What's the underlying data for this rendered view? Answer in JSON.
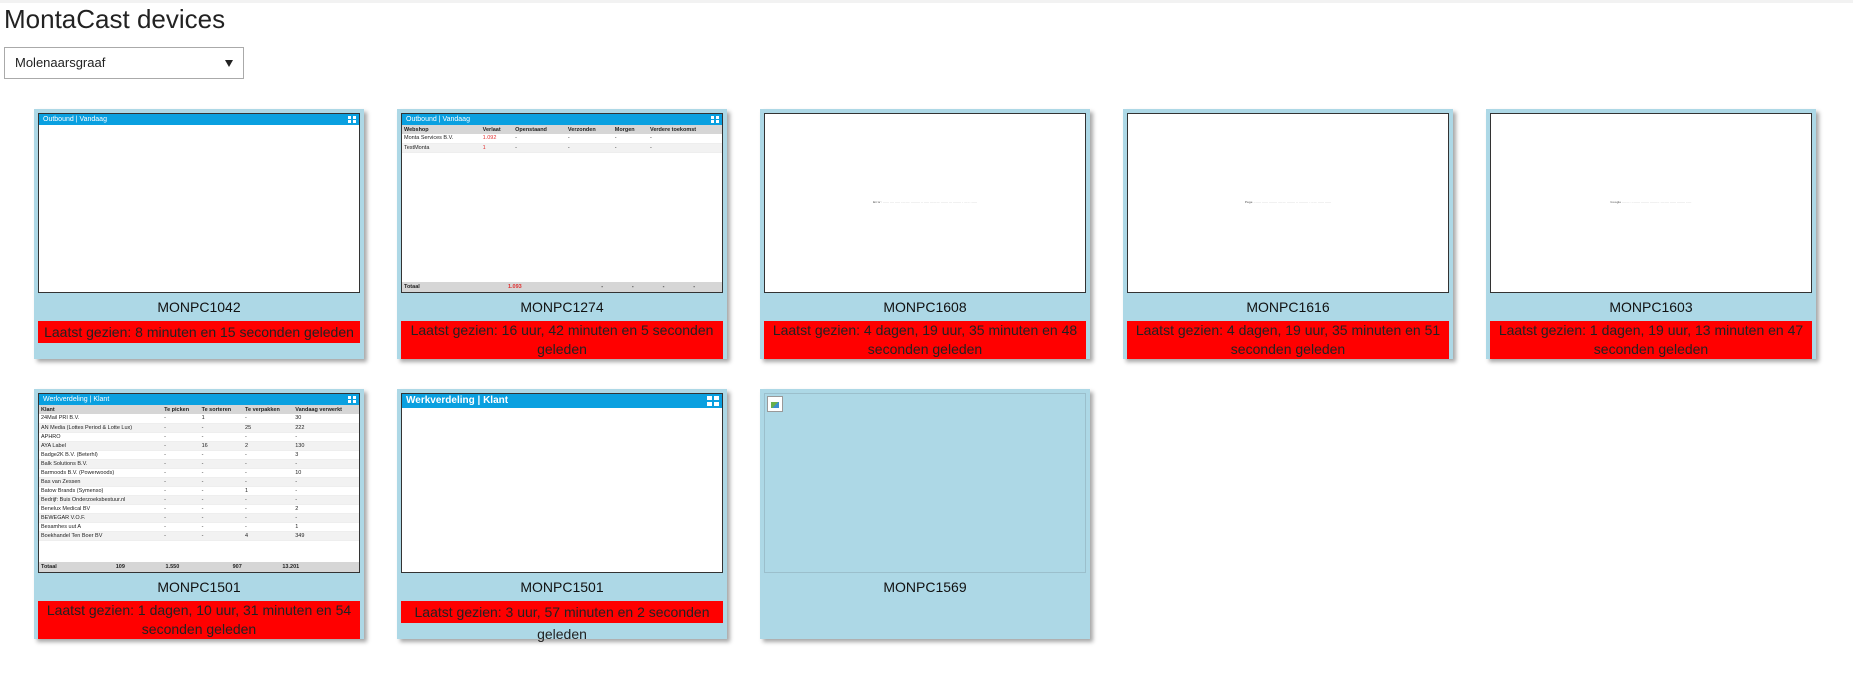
{
  "page": {
    "title": "MontaCast devices"
  },
  "location_select": {
    "value": "Molenaarsgraaf"
  },
  "colors": {
    "card_bg": "#add8e6",
    "status_red": "#ff0000",
    "panel_blue": "#0aa0e0"
  },
  "devices": [
    {
      "name": "MONPC1042",
      "last_seen": "Laatst gezien: 8 minuten en 15 seconden geleden",
      "screen": {
        "panel_title": "Outbound | Vandaag"
      }
    },
    {
      "name": "MONPC1274",
      "last_seen": "Laatst gezien: 16 uur, 42 minuten en 5 seconden geleden",
      "screen": {
        "panel_title": "Outbound | Vandaag",
        "headers": [
          "Webshop",
          "Verlaat",
          "Openstaand",
          "Verzonden",
          "Morgen",
          "Verdere toekomst"
        ],
        "rows": [
          [
            "Monta Services B.V.",
            "1.092",
            "-",
            "-",
            "-",
            "-"
          ],
          [
            "TestMonta",
            "1",
            "-",
            "-",
            "-",
            "-"
          ]
        ],
        "total": [
          "Totaal",
          "1.093",
          "-",
          "-",
          "-",
          "-"
        ]
      }
    },
    {
      "name": "MONPC1608",
      "last_seen": "Laatst gezien: 4 dagen, 19 uur, 35 minuten en 48 seconden geleden",
      "screen": {
        "tiny_text": "Error: ...... .... ..... ........ ......... .. ..... ......... ....... ... ........ . ..... ......"
      }
    },
    {
      "name": "MONPC1616",
      "last_seen": "Laatst gezien: 4 dagen, 19 uur, 35 minuten en 51 seconden geleden",
      "screen": {
        "tiny_text": "Page ....... ...... ........ ....... ........ .. ......... . ..... ...... ......"
      }
    },
    {
      "name": "MONPC1603",
      "last_seen": "Laatst gezien: 1 dagen, 19 uur, 13 minuten en 47 seconden geleden",
      "screen": {
        "tiny_text": "Google ........ ........ ........ ......... ........ ...... ........ ....."
      }
    },
    {
      "name": "MONPC1501",
      "last_seen": "Laatst gezien: 1 dagen, 10 uur, 31 minuten en 54 seconden geleden",
      "screen": {
        "panel_title": "Werkverdeling | Klant",
        "headers": [
          "Klant",
          "Te picken",
          "Te sorteren",
          "Te verpakken",
          "Vandaag verwerkt"
        ],
        "rows": [
          [
            "24Mail PRI B.V.",
            "-",
            "1",
            "-",
            "30"
          ],
          [
            "AN Media (Lottes Period & Lotte Lux)",
            "-",
            "-",
            "25",
            "222"
          ],
          [
            "APHRO",
            "-",
            "-",
            "-",
            "-"
          ],
          [
            "AYA Label",
            "-",
            "16",
            "2",
            "130"
          ],
          [
            "Badge2K B.V. (Beterhl)",
            "-",
            "-",
            "-",
            "3"
          ],
          [
            "Balk Solutions B.V.",
            "-",
            "-",
            "-",
            "-"
          ],
          [
            "Barmoods B.V. (Powerwoods)",
            "-",
            "-",
            "-",
            "10"
          ],
          [
            "Bas van Zessen",
            "-",
            "-",
            "-",
            "-"
          ],
          [
            "Batow Brands (Symenso)",
            "-",
            "-",
            "1",
            "-"
          ],
          [
            "Bedrijf: Buis Onderzoeksbestuur.nl",
            "-",
            "-",
            "-",
            "-"
          ],
          [
            "Benelux Medical BV",
            "-",
            "-",
            "-",
            "2"
          ],
          [
            "BEWEGAR V.O.F.",
            "-",
            "-",
            "-",
            "-"
          ],
          [
            "Besamhes uut A",
            "-",
            "-",
            "-",
            "1"
          ],
          [
            "Boekhandel Ten Boer BV",
            "-",
            "-",
            "4",
            "349"
          ]
        ],
        "total": [
          "Totaal",
          "109",
          "1.550",
          "907",
          "13.201"
        ]
      }
    },
    {
      "name": "MONPC1501",
      "last_seen": "Laatst gezien: 3 uur, 57 minuten en 2 seconden geleden",
      "screen": {
        "panel_title": "Werkverdeling | Klant"
      }
    },
    {
      "name": "MONPC1569",
      "last_seen": "",
      "screen": {}
    }
  ]
}
